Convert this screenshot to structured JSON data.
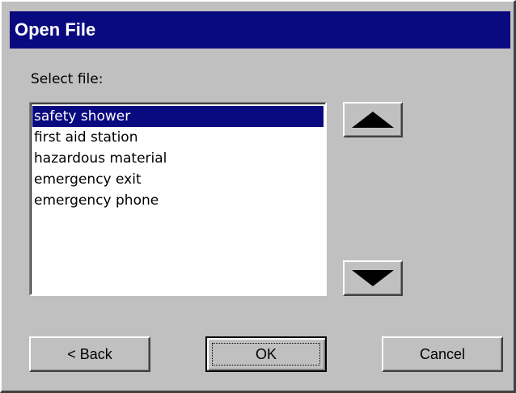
{
  "dialog": {
    "title": "Open File",
    "select_label": "Select file:"
  },
  "files": [
    {
      "name": "safety shower",
      "selected": true
    },
    {
      "name": "first aid station",
      "selected": false
    },
    {
      "name": "hazardous material",
      "selected": false
    },
    {
      "name": "emergency exit",
      "selected": false
    },
    {
      "name": "emergency phone",
      "selected": false
    }
  ],
  "buttons": {
    "back": "< Back",
    "ok": "OK",
    "cancel": "Cancel"
  },
  "icons": {
    "scroll_up": "triangle-up-icon",
    "scroll_down": "triangle-down-icon"
  },
  "colors": {
    "title_bar": "#0a0a80",
    "selection": "#0a0a80",
    "face": "#c0c0c0"
  }
}
